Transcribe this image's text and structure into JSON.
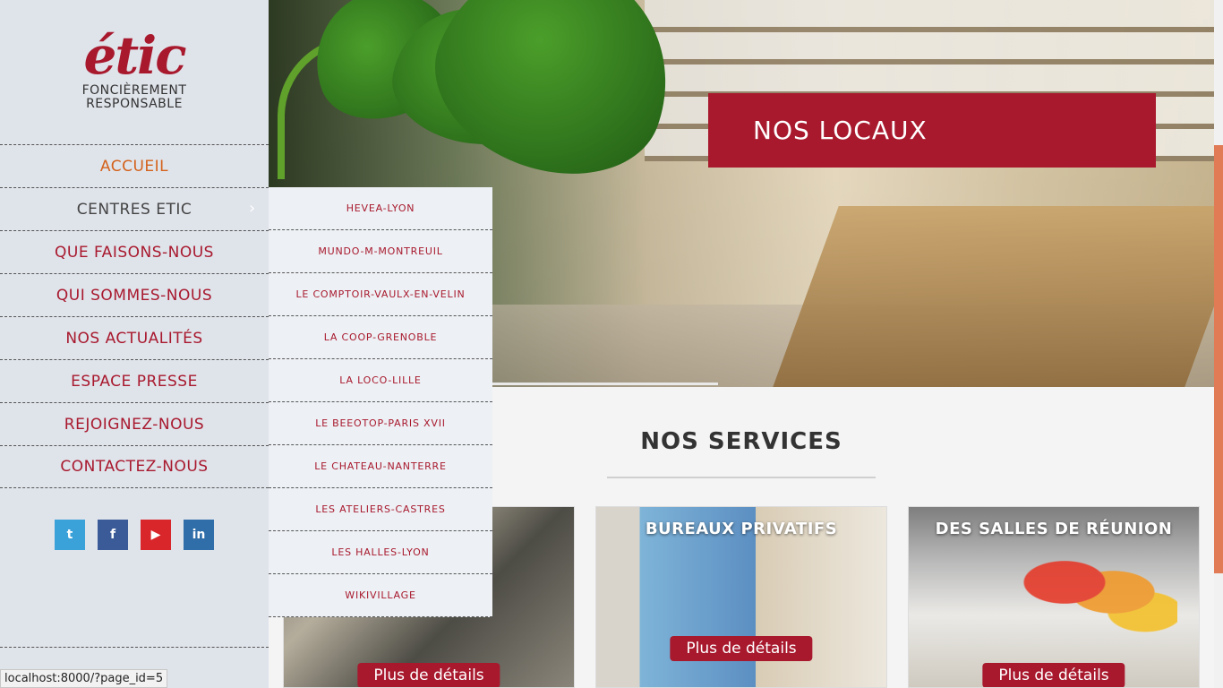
{
  "logo": {
    "script": "étic",
    "line1": "FONCIÈREMENT",
    "line2": "RESPONSABLE"
  },
  "menu": [
    {
      "label": "ACCUEIL",
      "state": "active"
    },
    {
      "label": "CENTRES ETIC",
      "state": "open"
    },
    {
      "label": "QUE FAISONS-NOUS",
      "state": ""
    },
    {
      "label": "QUI SOMMES-NOUS",
      "state": ""
    },
    {
      "label": "NOS ACTUALITÉS",
      "state": ""
    },
    {
      "label": "ESPACE PRESSE",
      "state": ""
    },
    {
      "label": "REJOIGNEZ-NOUS",
      "state": ""
    },
    {
      "label": "CONTACTEZ-NOUS",
      "state": ""
    }
  ],
  "submenu": [
    "HEVEA-LYON",
    "MUNDO-M-MONTREUIL",
    "LE COMPTOIR-VAULX-EN-VELIN",
    "LA COOP-GRENOBLE",
    "LA LOCO-LILLE",
    "LE BEEOTOP-PARIS XVII",
    "LE CHATEAU-NANTERRE",
    "LES ATELIERS-CASTRES",
    "LES HALLES-LYON",
    "WIKIVILLAGE"
  ],
  "socials": [
    {
      "name": "twitter-icon",
      "glyph": "t"
    },
    {
      "name": "facebook-icon",
      "glyph": "f"
    },
    {
      "name": "youtube-icon",
      "glyph": "▶"
    },
    {
      "name": "linkedin-icon",
      "glyph": "in"
    }
  ],
  "hero": {
    "caption": "NOS LOCAUX"
  },
  "services": {
    "title": "NOS SERVICES",
    "cards": [
      {
        "title": "",
        "button": "Plus de détails"
      },
      {
        "title": "BUREAUX PRIVATIFS",
        "button": "Plus de détails"
      },
      {
        "title": "DES SALLES DE RÉUNION",
        "button": "Plus de détails"
      }
    ]
  },
  "status_bar": {
    "url": "localhost:8000/?page_id=5"
  },
  "colors": {
    "brand": "#a8192e",
    "active_menu": "#d4621b",
    "sidebar_bg": "#dfe3ea"
  }
}
